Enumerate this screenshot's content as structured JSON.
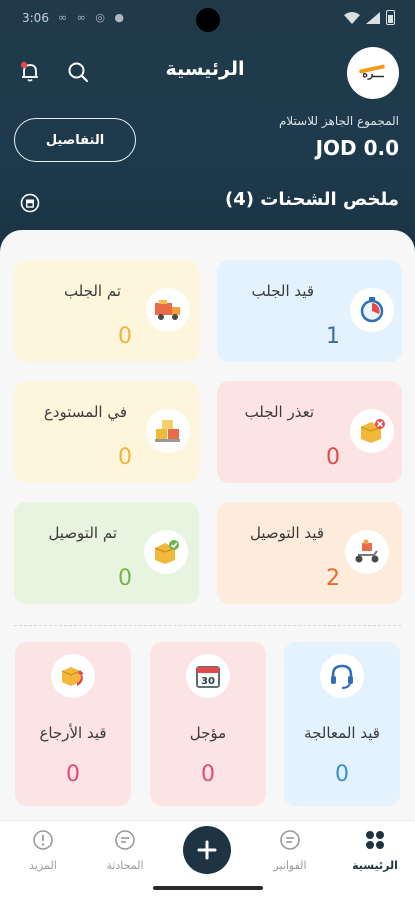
{
  "status_bar": {
    "time": "3:06"
  },
  "header": {
    "title": "الرئيسية",
    "details_button": "التفاصيل",
    "ready_label": "المجموع الجاهز للاستلام",
    "ready_amount": "JOD 0.0",
    "summary_title": "ملخص الشحنات (4)"
  },
  "cards": {
    "pickup_pending": {
      "label": "قيد الجلب",
      "count": "1"
    },
    "picked_up": {
      "label": "تم الجلب",
      "count": "0"
    },
    "pickup_failed": {
      "label": "تعذر الجلب",
      "count": "0"
    },
    "in_warehouse": {
      "label": "في المستودع",
      "count": "0"
    },
    "out_for_delivery": {
      "label": "قيد التوصيل",
      "count": "2"
    },
    "delivered": {
      "label": "تم التوصيل",
      "count": "0"
    }
  },
  "bottom_cards": {
    "processing": {
      "label": "قيد المعالجة",
      "count": "0"
    },
    "postponed": {
      "label": "مؤجل",
      "count": "0"
    },
    "returning": {
      "label": "قيد الأرجاع",
      "count": "0"
    }
  },
  "nav": {
    "home": "الرئيسية",
    "invoices": "الفواتير",
    "chat": "المحادثة",
    "more": "المزيد"
  },
  "colors": {
    "header_bg": "#1e3442",
    "blue_card": "#e3f2fc",
    "yellow_card": "#fdf6dc",
    "pink_card": "#fde4e4",
    "orange_card": "#fdebdc",
    "green_card": "#e7f4df"
  },
  "icons": [
    "bell-icon",
    "search-icon",
    "archive-icon",
    "timer-icon",
    "truck-icon",
    "box-x-icon",
    "warehouse-icon",
    "scooter-icon",
    "box-check-icon",
    "headset-icon",
    "calendar-icon",
    "box-return-icon",
    "grid-icon",
    "invoice-icon",
    "chat-icon",
    "more-icon",
    "plus-icon"
  ]
}
